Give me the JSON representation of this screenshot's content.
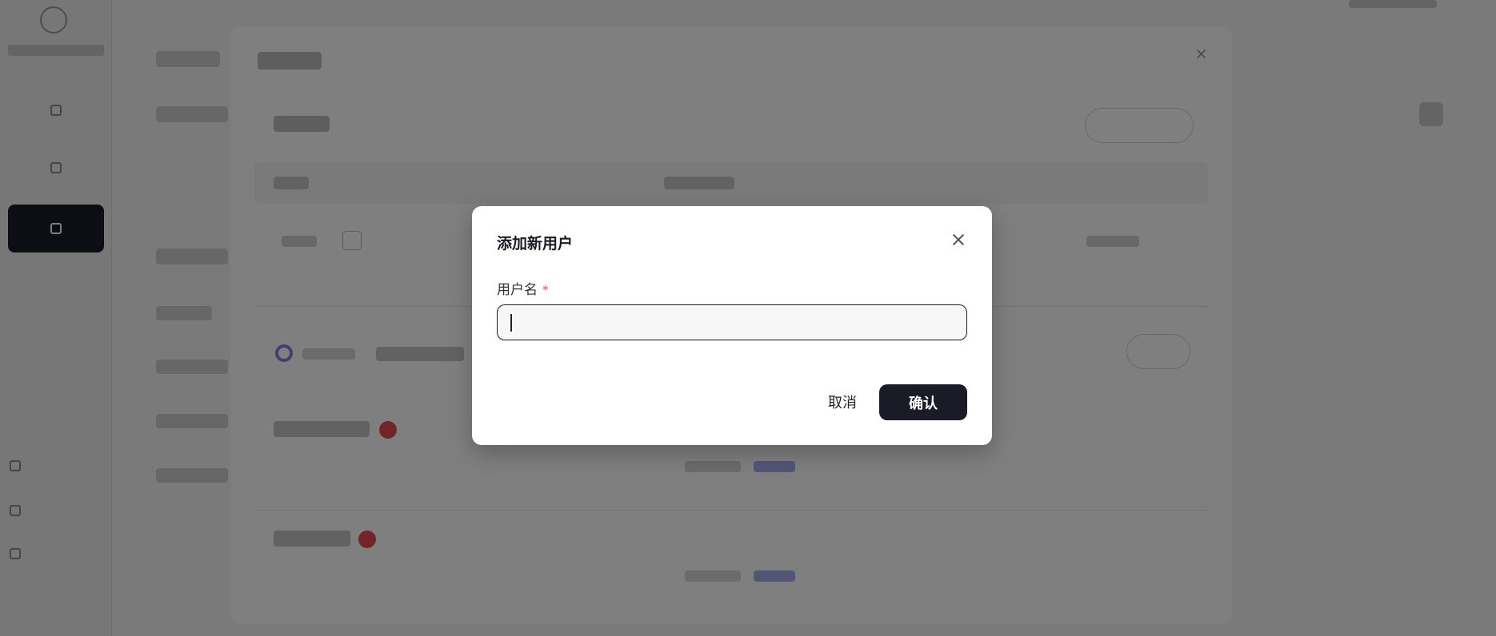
{
  "modal": {
    "title": "添加新用户",
    "field_label": "用户名",
    "required_mark": "*",
    "input_value": "",
    "cancel_label": "取消",
    "confirm_label": "确认"
  },
  "colors": {
    "primary": "#1b1b28",
    "required": "#e5484d",
    "overlay": "rgba(0,0,0,0.5)"
  }
}
